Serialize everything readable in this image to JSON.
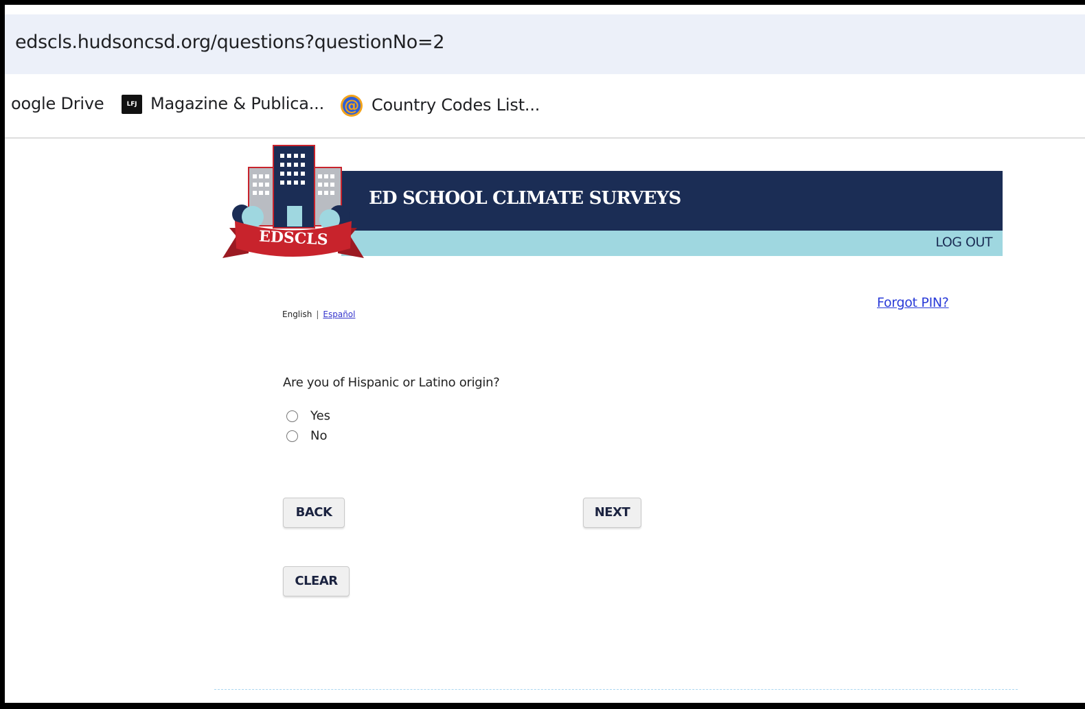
{
  "browser": {
    "url": "edscls.hudsoncsd.org/questions?questionNo=2",
    "bookmarks": [
      {
        "label": "oogle Drive",
        "icon": "google-drive-icon"
      },
      {
        "label": "Magazine & Publica...",
        "icon": "lfj-icon",
        "icon_text": "LFJ"
      },
      {
        "label": "Country Codes List...",
        "icon": "at-sign-icon"
      }
    ]
  },
  "header": {
    "logo_text": "EDSCLS",
    "title": "ED SCHOOL CLIMATE SURVEYS",
    "logout_label": "LOG OUT",
    "colors": {
      "banner_dark": "#1b2d55",
      "banner_light": "#9fd7e0",
      "ribbon_red": "#c8232c"
    }
  },
  "language": {
    "current": "English",
    "separator": "|",
    "alternate": "Español"
  },
  "forgot_pin_label": "Forgot PIN?",
  "survey": {
    "question": "Are you of Hispanic or Latino origin?",
    "options": [
      {
        "label": "Yes",
        "selected": false
      },
      {
        "label": "No",
        "selected": false
      }
    ]
  },
  "buttons": {
    "back": "BACK",
    "next": "NEXT",
    "clear": "CLEAR"
  }
}
